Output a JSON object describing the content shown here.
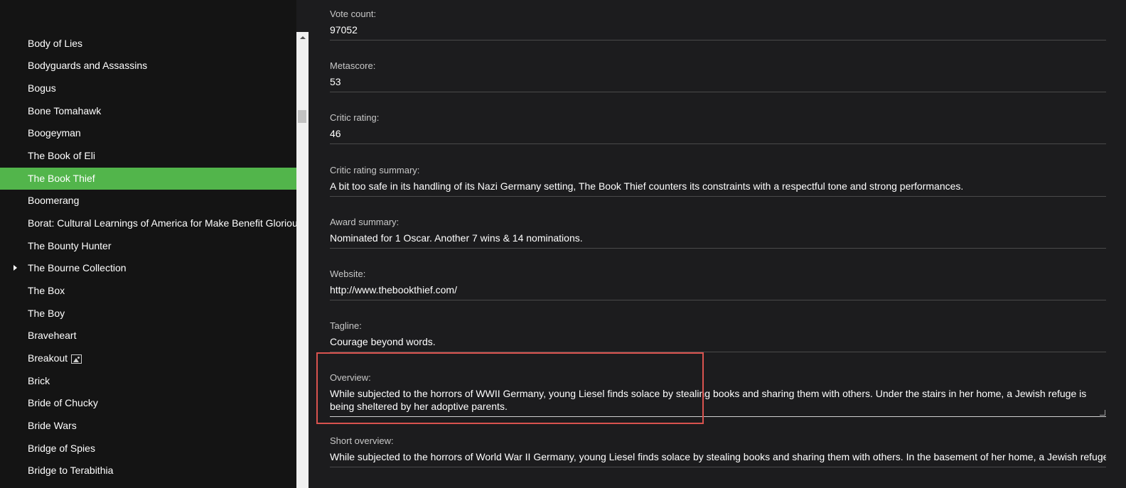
{
  "movie_list": {
    "items": [
      {
        "label": "Body of Lies"
      },
      {
        "label": "Bodyguards and Assassins"
      },
      {
        "label": "Bogus"
      },
      {
        "label": "Bone Tomahawk"
      },
      {
        "label": "Boogeyman"
      },
      {
        "label": "The Book of Eli"
      },
      {
        "label": "The Book Thief",
        "selected": true
      },
      {
        "label": "Boomerang"
      },
      {
        "label": "Borat: Cultural Learnings of America for Make Benefit Glorious Nation of Kazakhstan"
      },
      {
        "label": "The Bounty Hunter"
      },
      {
        "label": "The Bourne Collection",
        "icon": "expand-arrow-icon"
      },
      {
        "label": "The Box"
      },
      {
        "label": "The Boy"
      },
      {
        "label": "Braveheart"
      },
      {
        "label": "Breakout",
        "icon": "image-icon"
      },
      {
        "label": "Brick"
      },
      {
        "label": "Bride of Chucky"
      },
      {
        "label": "Bride Wars"
      },
      {
        "label": "Bridge of Spies"
      },
      {
        "label": "Bridge to Terabithia"
      }
    ],
    "selected_color": "#52b54b"
  },
  "details": {
    "vote_count": {
      "label": "Vote count:",
      "value": "97052"
    },
    "metascore": {
      "label": "Metascore:",
      "value": "53"
    },
    "critic_rating": {
      "label": "Critic rating:",
      "value": "46"
    },
    "critic_rating_summary": {
      "label": "Critic rating summary:",
      "value": "A bit too safe in its handling of its Nazi Germany setting, The Book Thief counters its constraints with a respectful tone and strong performances."
    },
    "award_summary": {
      "label": "Award summary:",
      "value": "Nominated for 1 Oscar. Another 7 wins & 14 nominations."
    },
    "website": {
      "label": "Website:",
      "value": "http://www.thebookthief.com/"
    },
    "tagline": {
      "label": "Tagline:",
      "value": "Courage beyond words."
    },
    "overview": {
      "label": "Overview:",
      "value": "While subjected to the horrors of WWII Germany, young Liesel finds solace by stealing books and sharing them with others. Under the stairs in her home, a Jewish refuge is being sheltered by her adoptive parents."
    },
    "short_overview": {
      "label": "Short overview:",
      "value": "While subjected to the horrors of World War II Germany, young Liesel finds solace by stealing books and sharing them with others. In the basement of her home, a Jewish refugee is being sheltered by her adoptive parents."
    }
  },
  "highlight_color": "#d9534f"
}
